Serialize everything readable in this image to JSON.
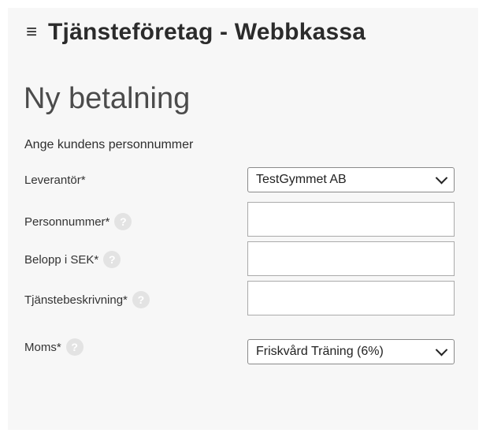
{
  "header": {
    "menu_glyph": "≡",
    "title": "Tjänsteföretag - Webbkassa"
  },
  "page": {
    "title": "Ny betalning",
    "instruction": "Ange kundens personnummer"
  },
  "form": {
    "supplier": {
      "label": "Leverantör*",
      "value": "TestGymmet AB"
    },
    "personal_number": {
      "label": "Personnummer*",
      "value": "",
      "help": "?"
    },
    "amount": {
      "label": "Belopp i SEK*",
      "value": "",
      "help": "?"
    },
    "description": {
      "label": "Tjänstebeskrivning*",
      "value": "",
      "help": "?"
    },
    "vat": {
      "label": "Moms*",
      "value": "Friskvård Träning (6%)",
      "help": "?"
    }
  }
}
